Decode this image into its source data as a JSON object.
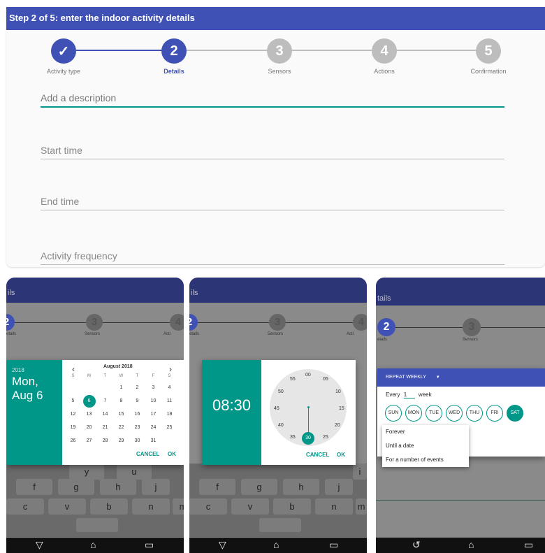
{
  "main": {
    "title": "Step 2 of 5: enter the indoor activity details",
    "steps": [
      {
        "num": "✓",
        "label": "Activity type",
        "state": "done"
      },
      {
        "num": "2",
        "label": "Details",
        "state": "active"
      },
      {
        "num": "3",
        "label": "Sensors",
        "state": "todo"
      },
      {
        "num": "4",
        "label": "Actions",
        "state": "todo"
      },
      {
        "num": "5",
        "label": "Confirmation",
        "state": "todo"
      }
    ],
    "fields": {
      "description": "Add a description",
      "start": "Start time",
      "end": "End time",
      "frequency": "Activity frequency"
    }
  },
  "panels": {
    "bar_text": "tails",
    "bar_text_p2": "ils",
    "bar_text_p1": "ils",
    "step_details": "etails",
    "step_sensors": "Sensors",
    "step_acti": "Acti",
    "step_num2": "2",
    "step_num3": "3",
    "step_num4": "4"
  },
  "datepicker": {
    "year": "2018",
    "date_line1": "Mon,",
    "date_line2": "Aug 6",
    "month": "August 2018",
    "prev": "‹",
    "next": "›",
    "weekdays": [
      "S",
      "M",
      "T",
      "W",
      "T",
      "F",
      "S"
    ],
    "weeks": [
      [
        "",
        "",
        "",
        "1",
        "2",
        "3",
        "4"
      ],
      [
        "5",
        "6",
        "7",
        "8",
        "9",
        "10",
        "11"
      ],
      [
        "12",
        "13",
        "14",
        "15",
        "16",
        "17",
        "18"
      ],
      [
        "19",
        "20",
        "21",
        "22",
        "23",
        "24",
        "25"
      ],
      [
        "26",
        "27",
        "28",
        "29",
        "30",
        "31",
        ""
      ]
    ],
    "selected": "6",
    "cancel": "CANCEL",
    "ok": "OK"
  },
  "timepicker": {
    "time": "08:30",
    "minutes": [
      "00",
      "05",
      "10",
      "15",
      "20",
      "25",
      "30",
      "35",
      "40",
      "45",
      "50",
      "55"
    ],
    "selected": "30",
    "cancel": "CANCEL",
    "ok": "OK"
  },
  "repeat": {
    "title": "REPEAT WEEKLY",
    "every": "Every",
    "count": "1",
    "unit": "week",
    "days": [
      "SUN",
      "MON",
      "TUE",
      "WED",
      "THU",
      "FRI",
      "SAT"
    ],
    "selected_day": "SAT",
    "menu": [
      "Forever",
      "Until a date",
      "For a number of events"
    ]
  },
  "keyboard": {
    "row1": [
      "",
      "t",
      "y",
      "u",
      "i"
    ],
    "row2": [
      "f",
      "g",
      "h",
      "j"
    ],
    "row3": [
      "c",
      "v",
      "b",
      "n",
      "m"
    ]
  },
  "colors": {
    "primary": "#3f51b5",
    "accent": "#009688",
    "inactive": "#bdbdbd"
  }
}
